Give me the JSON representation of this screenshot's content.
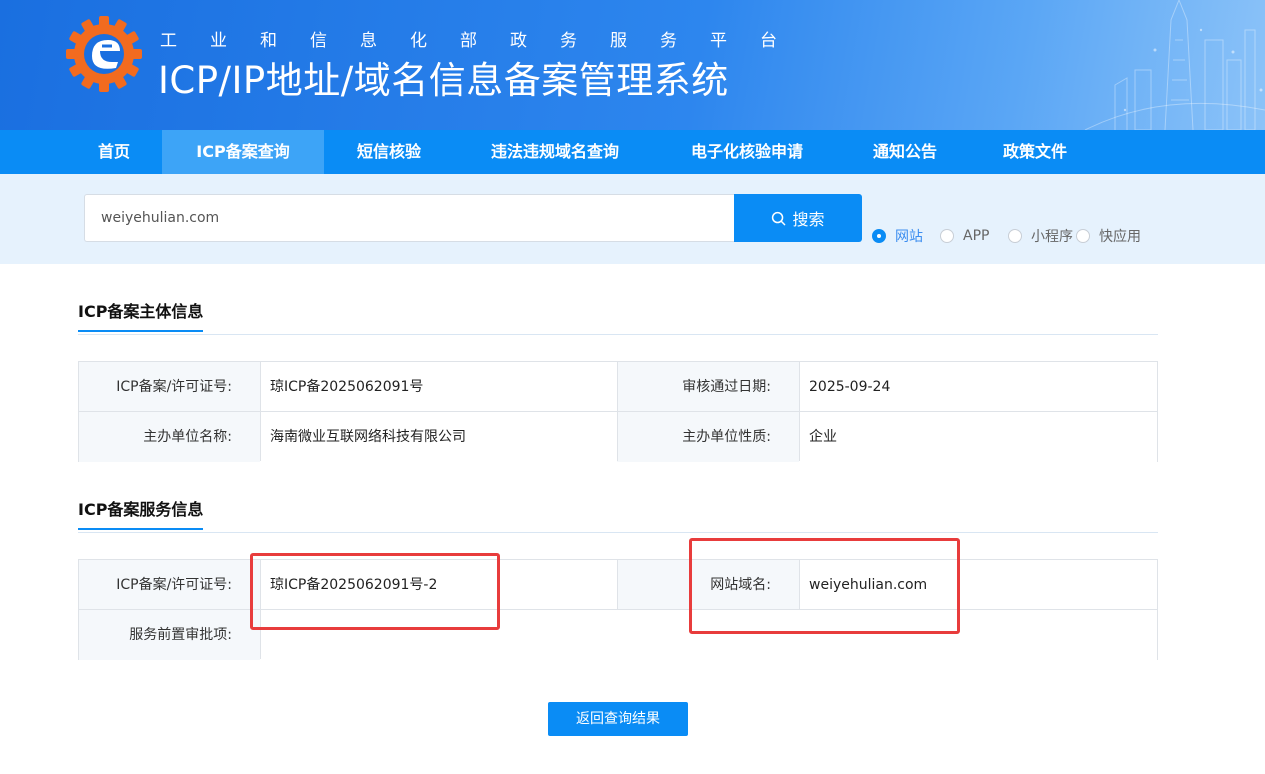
{
  "header": {
    "subtitle": "工业和信息化部政务服务平台",
    "title": "ICP/IP地址/域名信息备案管理系统"
  },
  "nav": {
    "items": [
      "首页",
      "ICP备案查询",
      "短信核验",
      "违法违规域名查询",
      "电子化核验申请",
      "通知公告",
      "政策文件"
    ],
    "active": "ICP备案查询"
  },
  "search": {
    "value": "weiyehulian.com",
    "button_label": "搜索",
    "types": [
      "网站",
      "APP",
      "小程序",
      "快应用"
    ],
    "selected_type": "网站"
  },
  "subject_info": {
    "title": "ICP备案主体信息",
    "license_label": "ICP备案/许可证号:",
    "license_value": "琼ICP备2025062091号",
    "approve_date_label": "审核通过日期:",
    "approve_date_value": "2025-09-24",
    "org_name_label": "主办单位名称:",
    "org_name_value": "海南微业互联网络科技有限公司",
    "org_type_label": "主办单位性质:",
    "org_type_value": "企业"
  },
  "service_info": {
    "title": "ICP备案服务信息",
    "license_label": "ICP备案/许可证号:",
    "license_value": "琼ICP备2025062091号-2",
    "domain_label": "网站域名:",
    "domain_value": "weiyehulian.com",
    "pre_approval_label": "服务前置审批项:",
    "pre_approval_value": ""
  },
  "back_button_label": "返回查询结果",
  "colors": {
    "primary": "#0a8cf5",
    "nav_active": "#3da4f7",
    "highlight": "#e83c3c",
    "search_band": "#e6f2fd"
  }
}
